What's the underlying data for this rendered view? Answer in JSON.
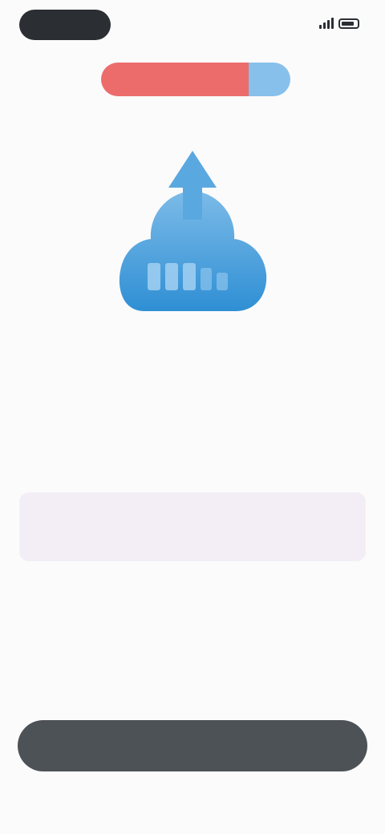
{
  "brand": {
    "name": "",
    "badge": ""
  },
  "header": {
    "subtitle": ""
  },
  "hero": {
    "caption": ""
  },
  "stats": [
    {
      "value": "",
      "label": ""
    },
    {
      "value": "",
      "label": ""
    },
    {
      "value": "",
      "label": ""
    }
  ],
  "info_card": {
    "left_title": "",
    "left_sub": "",
    "right_title": "",
    "right_sub": ""
  },
  "description": "",
  "footnote": "",
  "actions": {
    "primary_label": "",
    "secondary_label": ""
  },
  "colors": {
    "brand_red": "#ec6c6c",
    "brand_blue": "#88c0ec",
    "cloud_blue": "#3e9ad8",
    "button_dark": "#4d5257",
    "card_bg": "#f3eef6"
  },
  "icons": {
    "hero": "cloud-upload-icon"
  }
}
